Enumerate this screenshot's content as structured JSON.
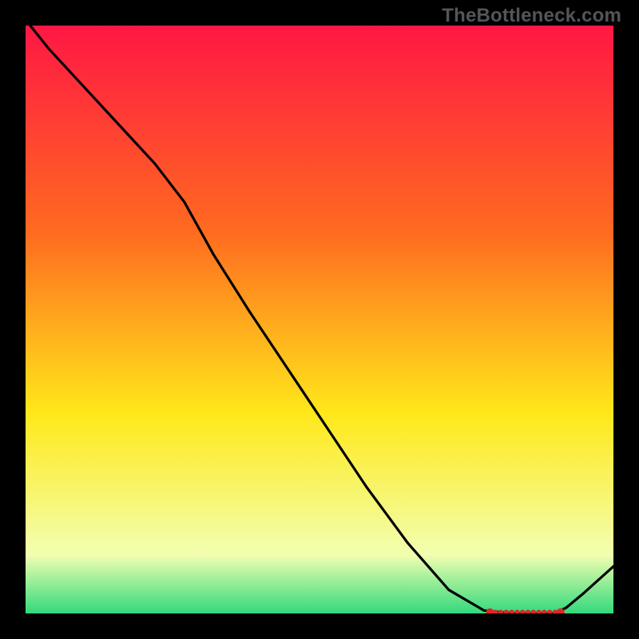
{
  "watermark": "TheBottleneck.com",
  "chart_data": {
    "type": "line",
    "title": "",
    "xlabel": "",
    "ylabel": "",
    "xlim": [
      0,
      100
    ],
    "ylim": [
      0,
      100
    ],
    "grid": false,
    "legend": false,
    "background_gradient": {
      "top": "#ff1744",
      "upper": "#ff6a20",
      "mid": "#ffe81a",
      "lower": "#f2ffb0",
      "bottom": "#33d97d"
    },
    "series": [
      {
        "name": "curve",
        "x": [
          0,
          4,
          10,
          16,
          22,
          27,
          32,
          38,
          45,
          52,
          58,
          65,
          72,
          78,
          83,
          85,
          88,
          90,
          92,
          95,
          100
        ],
        "y": [
          101,
          96,
          89.5,
          83,
          76.5,
          70,
          61,
          51.5,
          41,
          30.5,
          21.5,
          12,
          4,
          0.5,
          0,
          0,
          0,
          0,
          1,
          3.5,
          8
        ]
      }
    ],
    "markers": {
      "name": "baseline-dots",
      "x_start": 79,
      "x_end": 91,
      "y": 0.2,
      "count": 14,
      "color": "#dc2828"
    }
  }
}
